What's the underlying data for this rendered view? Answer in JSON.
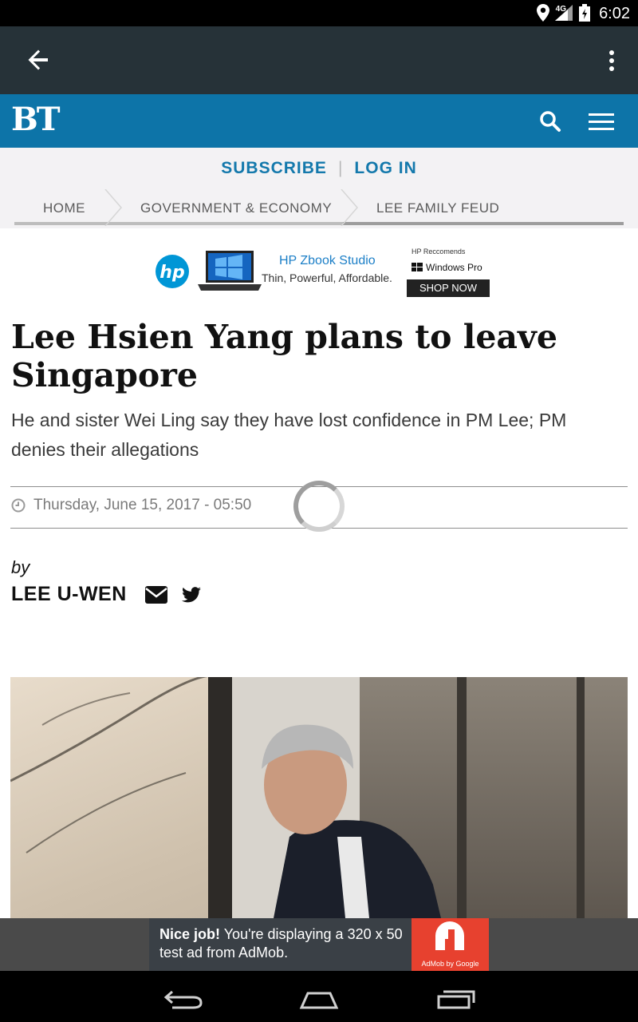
{
  "status_bar": {
    "time": "6:02",
    "network": "4G",
    "icons": [
      "location-icon",
      "signal-icon",
      "battery-icon"
    ]
  },
  "app_bar": {
    "icons": [
      "back-arrow-icon",
      "overflow-menu-icon"
    ]
  },
  "site_header": {
    "logo": "BT",
    "brand_color": "#0d74a8",
    "icons": [
      "search-icon",
      "hamburger-menu-icon"
    ]
  },
  "account": {
    "subscribe_label": "SUBSCRIBE",
    "separator": "|",
    "login_label": "LOG IN"
  },
  "breadcrumbs": [
    {
      "label": "HOME"
    },
    {
      "label": "GOVERNMENT & ECONOMY"
    },
    {
      "label": "LEE FAMILY FEUD"
    }
  ],
  "ad_banner": {
    "brand": "hp",
    "product": "HP Zbook Studio",
    "tagline": "Thin, Powerful, Affordable.",
    "recommends": "HP Reccomends",
    "os": "Windows Pro",
    "cta": "SHOP NOW"
  },
  "article": {
    "headline": "Lee Hsien Yang plans to leave Singapore",
    "subhead": "He and sister Wei Ling say they have lost confidence in PM Lee; PM denies their allegations",
    "date": "Thursday, June 15, 2017 - 05:50",
    "by_label": "by",
    "author": "LEE U-WEN",
    "author_icons": [
      "email-icon",
      "twitter-icon"
    ]
  },
  "admob": {
    "bold_text": "Nice job!",
    "text": " You're displaying a 320 x 50 test ad from AdMob.",
    "logo_label": "AdMob by Google",
    "accent": "#e7412f"
  },
  "nav_bar": {
    "icons": [
      "back-nav-icon",
      "home-nav-icon",
      "recents-nav-icon"
    ]
  }
}
